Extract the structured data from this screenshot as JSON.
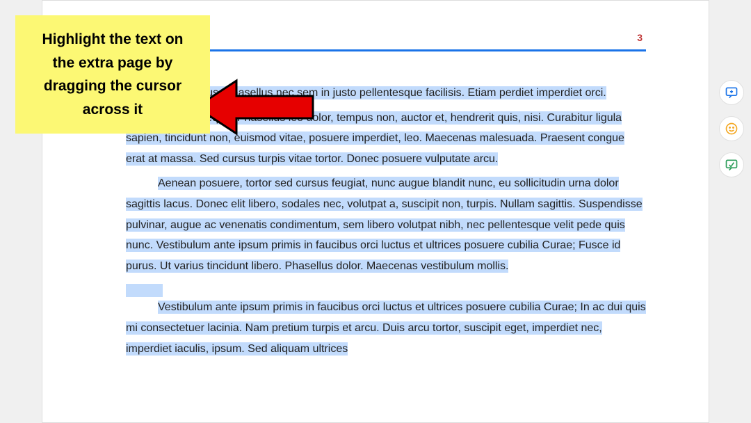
{
  "callout": {
    "text": "Highlight the text on the extra page by dragging the cursor across it"
  },
  "page_number": "3",
  "paragraphs": {
    "p1": "us                                          rerit risus. Phasellus nec sem in justo pellentesque facilisis. Etiam    perdiet imperdiet orci.",
    "p2": "unc nec neque. Phasellus leo dolor, tempus non, auctor et, hendrerit quis, nisi. Curabitur ligula sapien, tincidunt non, euismod vitae, posuere imperdiet, leo. Maecenas malesuada. Praesent congue erat at massa. Sed cursus turpis vitae tortor. Donec posuere vulputate arcu.",
    "p3": "Aenean posuere, tortor sed cursus feugiat, nunc augue blandit nunc, eu sollicitudin urna dolor sagittis lacus. Donec elit libero, sodales nec, volutpat a, suscipit non, turpis. Nullam sagittis. Suspendisse pulvinar, augue ac venenatis condimentum, sem libero volutpat nibh, nec pellentesque velit pede quis nunc. Vestibulum ante ipsum primis in faucibus orci luctus et ultrices posuere cubilia Curae; Fusce id purus. Ut varius tincidunt libero. Phasellus dolor. Maecenas vestibulum mollis.",
    "p4": "Vestibulum ante ipsum primis in faucibus orci luctus et ultrices posuere cubilia Curae; In ac dui quis mi consectetuer lacinia. Nam pretium turpis et arcu. Duis arcu tortor, suscipit eget, imperdiet nec, imperdiet iaculis, ipsum. Sed aliquam ultrices"
  }
}
